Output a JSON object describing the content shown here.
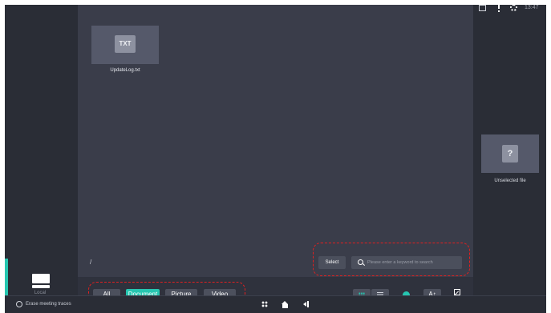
{
  "sidebar": {
    "local_label": "Local",
    "erase_label": "Erase meeting traces"
  },
  "main": {
    "files": [
      {
        "badge": "TXT",
        "name": "UpdateLog.txt"
      }
    ],
    "path": "/",
    "select_label": "Select",
    "search_placeholder": "Please enter a keyword to search"
  },
  "filters": {
    "all": "All",
    "document": "Document",
    "picture": "Picture",
    "video": "Video",
    "active": "Document"
  },
  "view": {
    "sort_label": "A↑"
  },
  "preview": {
    "placeholder_glyph": "?",
    "label": "Unselected file"
  },
  "taskbar": {
    "time": "13:47"
  },
  "colors": {
    "accent": "#26c6b0",
    "annotation": "#e02020",
    "background": "#3a3d4a"
  },
  "icons": [
    "drive-icon",
    "search-icon",
    "grid-view-icon",
    "list-view-icon",
    "edit-icon",
    "erase-icon",
    "apps-icon",
    "home-icon",
    "back-icon",
    "image-icon",
    "alert-icon",
    "gear-icon"
  ]
}
